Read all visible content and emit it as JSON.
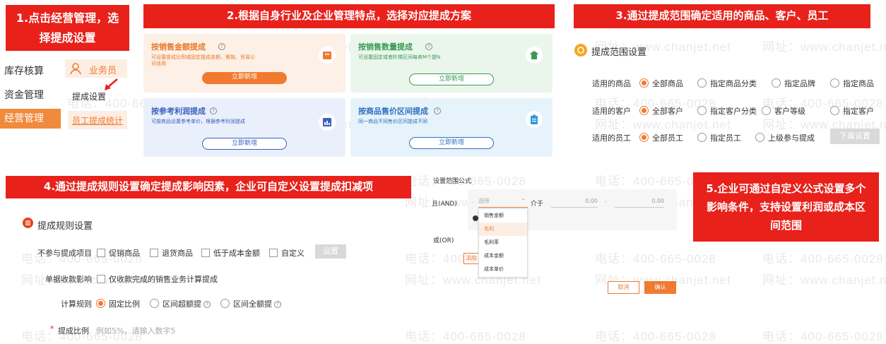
{
  "banners": {
    "b1": "1.点击经营管理，选择提成设置",
    "b2": "2.根据自身行业及企业管理特点，选择对应提成方案",
    "b3": "3.通过提成范围确定适用的商品、客户、员工",
    "b4": "4.通过提成规则设置确定提成影响因素，企业可自定义设置提成扣减项",
    "b5": "5.企业可通过自定义公式设置多个影响条件，支持设置利润或成本区间范围"
  },
  "watermarks": {
    "site": "网址：www.chanjet.net",
    "phone": "电话：400-665-0028"
  },
  "left_menu": {
    "items": [
      "库存核算",
      "资金管理",
      "经营管理"
    ],
    "user_role": "业务员",
    "submenu": [
      "提成设置",
      "员工提成统计"
    ]
  },
  "plans": [
    {
      "title": "按销售金额提成",
      "desc": "可设置提成比例或固定提成金额，需按、贸易公司适用",
      "button": "立即新增"
    },
    {
      "title": "按销售数量提成",
      "desc": "可设置固定或者阶梯区间每卖M个提N",
      "button": "立即新增"
    },
    {
      "title": "按参考利润提成",
      "desc": "可按商品设置参考单价，根据参考利润提成",
      "button": "立即新增"
    },
    {
      "title": "按商品售价区间提成",
      "desc": "同一商品不同售价区间提成不同",
      "button": "立即新增"
    }
  ],
  "scope": {
    "title": "提成范围设置",
    "rows": [
      {
        "label": "适用的商品",
        "options": [
          "全部商品",
          "指定商品分类",
          "指定品牌",
          "指定商品"
        ]
      },
      {
        "label": "适用的客户",
        "options": [
          "全部客户",
          "指定客户分类",
          "客户等级",
          "指定客户"
        ]
      },
      {
        "label": "适用的员工",
        "options": [
          "全部员工",
          "指定员工",
          "上级参与提成"
        ]
      }
    ],
    "sub_button": "下属设置"
  },
  "rules": {
    "title": "提成规则设置",
    "exclude_label": "不参与提成项目",
    "exclude_options": [
      "促销商品",
      "退货商品",
      "低于成本金额",
      "自定义"
    ],
    "exclude_button": "设置",
    "receipt_label": "单据收款影响",
    "receipt_option": "仅收款完成的销售业务计算提成",
    "calc_label": "计算规则",
    "calc_options": [
      "固定比例",
      "区间超额提",
      "区间全额提"
    ],
    "ratio_required": "*",
    "ratio_label": "提成比例",
    "ratio_placeholder": "例如5%，请输入数字5"
  },
  "formula": {
    "title": "设置范围公式",
    "and_label": "且(AND)",
    "select_placeholder": "选择",
    "between": "介于",
    "min": "0.00",
    "max": "0.00",
    "dash": "-",
    "or_label": "或(OR)",
    "add_label": "添加",
    "dropdown": [
      "销售金额",
      "毛利",
      "毛利率",
      "成本金额",
      "成本单价"
    ],
    "cancel": "取消",
    "confirm": "确认"
  },
  "colors": {
    "accent": "#e8211b",
    "orange": "#f07a30"
  }
}
